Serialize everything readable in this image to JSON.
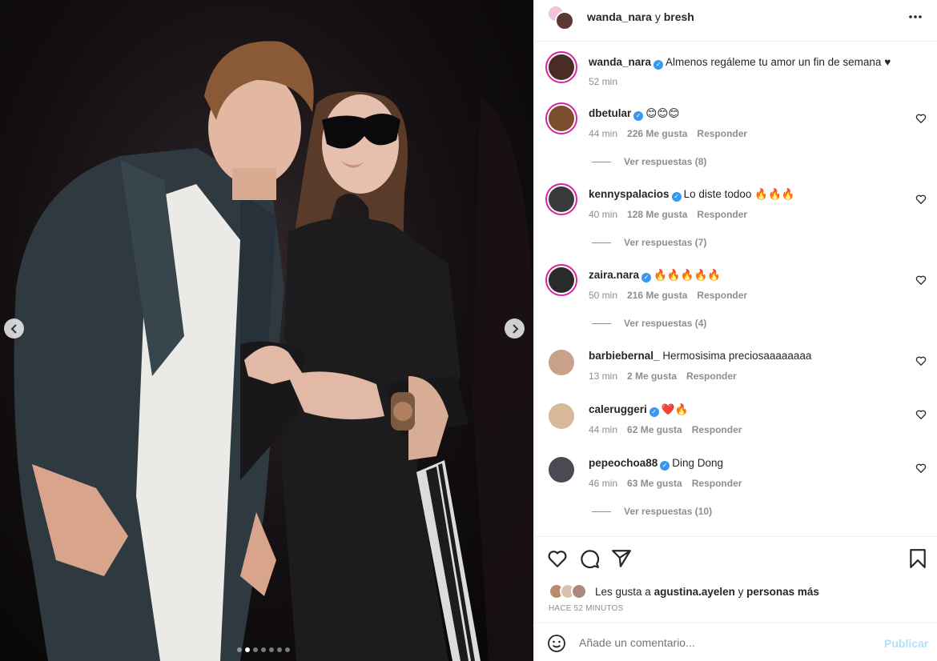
{
  "post": {
    "header_user": "wanda_nara",
    "header_joiner": " y ",
    "header_collab": "bresh",
    "caption_user": "wanda_nara",
    "caption_text": "Almenos regáleme tu amor un fin de semana ♥",
    "caption_time": "52 min"
  },
  "carousel": {
    "total": 7,
    "active": 1
  },
  "comments": [
    {
      "user": "dbetular",
      "verified": true,
      "text": "😊😊😊",
      "time": "44 min",
      "likes": "226 Me gusta",
      "reply": "Responder",
      "view_replies": "Ver respuestas (8)"
    },
    {
      "user": "kennyspalacios",
      "verified": true,
      "text": "Lo diste todoo 🔥🔥🔥",
      "time": "40 min",
      "likes": "128 Me gusta",
      "reply": "Responder",
      "view_replies": "Ver respuestas (7)"
    },
    {
      "user": "zaira.nara",
      "verified": true,
      "text": "🔥🔥🔥🔥🔥",
      "time": "50 min",
      "likes": "216 Me gusta",
      "reply": "Responder",
      "view_replies": "Ver respuestas (4)"
    },
    {
      "user": "barbiebernal_",
      "verified": false,
      "text": "Hermosisima preciosaaaaaaaa",
      "time": "13 min",
      "likes": "2 Me gusta",
      "reply": "Responder",
      "view_replies": ""
    },
    {
      "user": "caleruggeri",
      "verified": true,
      "text": "❤️🔥",
      "time": "44 min",
      "likes": "62 Me gusta",
      "reply": "Responder",
      "view_replies": ""
    },
    {
      "user": "pepeochoa88",
      "verified": true,
      "text": "Ding Dong",
      "time": "46 min",
      "likes": "63 Me gusta",
      "reply": "Responder",
      "view_replies": "Ver respuestas (10)"
    }
  ],
  "likes": {
    "prefix": "Les gusta a ",
    "user": "agustina.ayelen",
    "joiner": " y ",
    "rest": "personas más"
  },
  "timestamp": "HACE 52 MINUTOS",
  "add_comment": {
    "placeholder": "Añade un comentario...",
    "post_label": "Publicar"
  },
  "icons": [
    "more-icon",
    "heart-icon",
    "comment-icon",
    "share-icon",
    "bookmark-icon",
    "emoji-icon",
    "chevron-left-icon",
    "chevron-right-icon"
  ],
  "colors": {
    "verified": "#3897f0",
    "publish": "#b2dffc",
    "ring": "#d6249f"
  }
}
